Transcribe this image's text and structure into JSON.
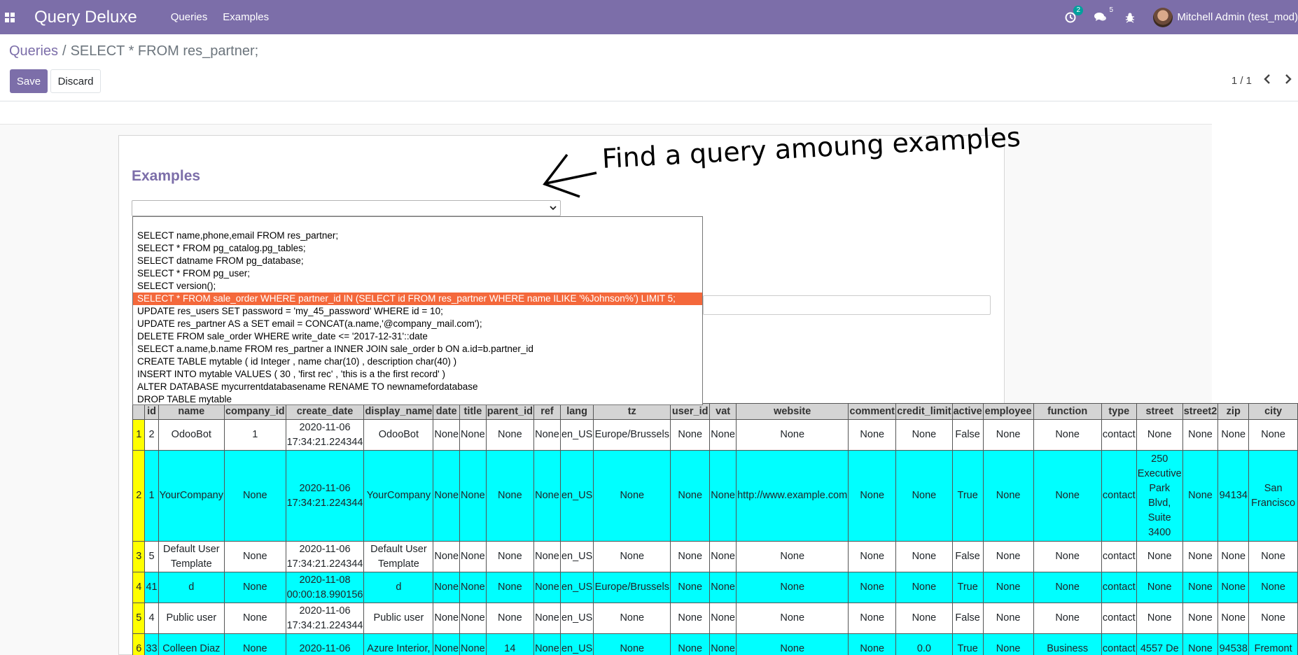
{
  "navbar": {
    "app_title": "Query Deluxe",
    "menu": [
      "Queries",
      "Examples"
    ],
    "activity_badge": "2",
    "messages_badge": "5",
    "user": "Mitchell Admin (test_mod)"
  },
  "control_panel": {
    "breadcrumb_parent": "Queries",
    "breadcrumb_separator": "/",
    "breadcrumb_current": "SELECT * FROM res_partner;",
    "save_label": "Save",
    "discard_label": "Discard",
    "pager": "1 / 1"
  },
  "form": {
    "examples_title": "Examples",
    "annotation": "Find a query amoung examples"
  },
  "dropdown": {
    "options": [
      "SELECT name,phone,email FROM res_partner;",
      "SELECT * FROM pg_catalog.pg_tables;",
      "SELECT datname FROM pg_database;",
      "SELECT * FROM pg_user;",
      "SELECT version();",
      "SELECT * FROM sale_order WHERE partner_id IN (SELECT id FROM res_partner WHERE name ILIKE '%Johnson%') LIMIT 5;",
      "UPDATE res_users SET password = 'my_45_password' WHERE id = 10;",
      "UPDATE res_partner AS a SET email = CONCAT(a.name,'@company_mail.com');",
      "DELETE FROM sale_order WHERE write_date <= '2017-12-31'::date",
      "SELECT a.name,b.name FROM res_partner a INNER JOIN sale_order b ON a.id=b.partner_id",
      "CREATE TABLE mytable ( id Integer , name char(10) , description char(40) )",
      "INSERT INTO mytable VALUES ( 30 , 'first rec' , 'this is a the first record' )",
      "ALTER DATABASE mycurrentdatabasename RENAME TO newnamefordatabase",
      "DROP TABLE mytable"
    ],
    "selected_index": 5
  },
  "table": {
    "columns": [
      "",
      "id",
      "name",
      "company_id",
      "create_date",
      "display_name",
      "date",
      "title",
      "parent_id",
      "ref",
      "lang",
      "tz",
      "user_id",
      "vat",
      "website",
      "comment",
      "credit_limit",
      "active",
      "employee",
      "function",
      "type",
      "street",
      "street2",
      "zip",
      "city"
    ],
    "rows": [
      [
        "1",
        "2",
        "OdooBot",
        "1",
        "2020-11-06 17:34:21.224344",
        "OdooBot",
        "None",
        "None",
        "None",
        "None",
        "en_US",
        "Europe/Brussels",
        "None",
        "None",
        "None",
        "None",
        "None",
        "False",
        "None",
        "None",
        "contact",
        "None",
        "None",
        "None",
        "None"
      ],
      [
        "2",
        "1",
        "YourCompany",
        "None",
        "2020-11-06 17:34:21.224344",
        "YourCompany",
        "None",
        "None",
        "None",
        "None",
        "en_US",
        "None",
        "None",
        "None",
        "http://www.example.com",
        "None",
        "None",
        "True",
        "None",
        "None",
        "contact",
        "250 Executive Park Blvd, Suite 3400",
        "None",
        "94134",
        "San Francisco"
      ],
      [
        "3",
        "5",
        "Default User Template",
        "None",
        "2020-11-06 17:34:21.224344",
        "Default User Template",
        "None",
        "None",
        "None",
        "None",
        "en_US",
        "None",
        "None",
        "None",
        "None",
        "None",
        "None",
        "False",
        "None",
        "None",
        "contact",
        "None",
        "None",
        "None",
        "None"
      ],
      [
        "4",
        "41",
        "d",
        "None",
        "2020-11-08 00:00:18.990156",
        "d",
        "None",
        "None",
        "None",
        "None",
        "en_US",
        "Europe/Brussels",
        "None",
        "None",
        "None",
        "None",
        "None",
        "True",
        "None",
        "None",
        "contact",
        "None",
        "None",
        "None",
        "None"
      ],
      [
        "5",
        "4",
        "Public user",
        "None",
        "2020-11-06 17:34:21.224344",
        "Public user",
        "None",
        "None",
        "None",
        "None",
        "en_US",
        "None",
        "None",
        "None",
        "None",
        "None",
        "None",
        "False",
        "None",
        "None",
        "contact",
        "None",
        "None",
        "None",
        "None"
      ],
      [
        "6",
        "33",
        "Colleen Diaz",
        "None",
        "2020-11-06",
        "Azure Interior,",
        "None",
        "None",
        "14",
        "None",
        "en_US",
        "None",
        "None",
        "None",
        "None",
        "None",
        "0.0",
        "True",
        "None",
        "Business",
        "contact",
        "4557 De",
        "None",
        "94538",
        "Fremont"
      ]
    ]
  }
}
